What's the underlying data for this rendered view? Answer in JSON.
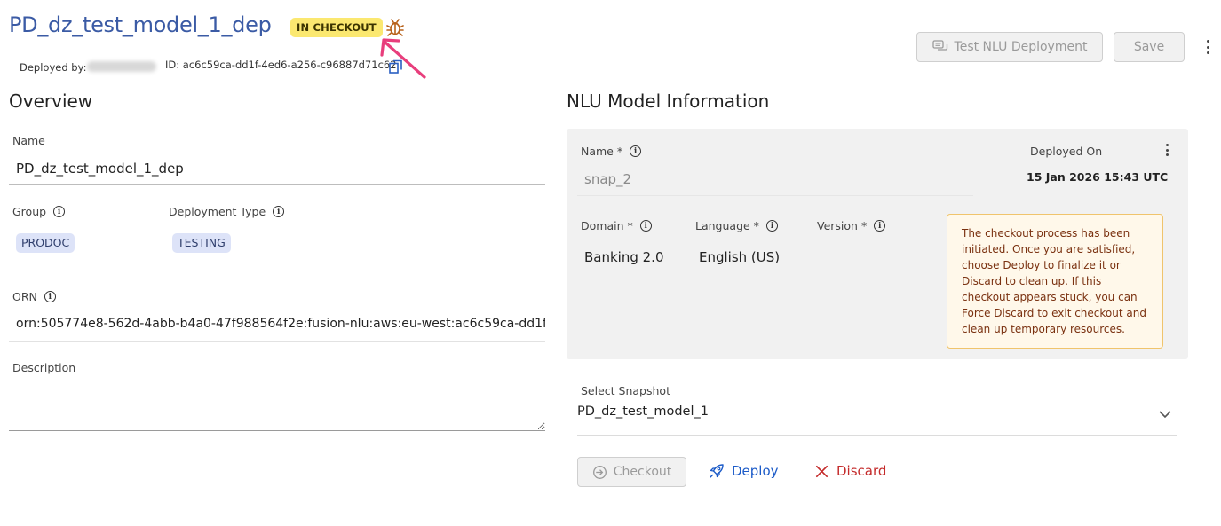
{
  "header": {
    "title": "PD_dz_test_model_1_dep",
    "status_badge": "IN CHECKOUT",
    "deployed_by_label": "Deployed by:",
    "id_text": "ID:  ac6c59ca-dd1f-4ed6-a256-c96887d71c62",
    "test_button": "Test NLU Deployment",
    "save_button": "Save"
  },
  "overview": {
    "heading": "Overview",
    "name_label": "Name",
    "name_value": "PD_dz_test_model_1_dep",
    "group_label": "Group",
    "group_value": "PRODOC",
    "deployment_type_label": "Deployment Type",
    "deployment_type_value": "TESTING",
    "orn_label": "ORN",
    "orn_value": "orn:505774e8-562d-4abb-b4a0-47f988564f2e:fusion-nlu:aws:eu-west:ac6c59ca-dd1f-",
    "description_label": "Description"
  },
  "nlu": {
    "heading": "NLU Model Information",
    "name_label": "Name *",
    "name_value": "snap_2",
    "deployed_on_label": "Deployed On",
    "deployed_on_value": "15 Jan 2026 15:43 UTC",
    "domain_label": "Domain *",
    "domain_value": "Banking 2.0",
    "language_label": "Language *",
    "language_value": "English (US)",
    "version_label": "Version *",
    "warning_text_1": "The checkout process has been initiated. Once you are satisfied, choose Deploy to finalize it or Discard to clean up. If this checkout appears stuck, you can ",
    "warning_link": "Force Discard",
    "warning_text_2": " to exit checkout and clean up temporary resources.",
    "snapshot_label": "Select Snapshot",
    "snapshot_value": "PD_dz_test_model_1"
  },
  "actions": {
    "checkout": "Checkout",
    "deploy": "Deploy",
    "discard": "Discard"
  },
  "colors": {
    "title": "#3b5ba5",
    "badge": "#fbe870",
    "annotation_arrow": "#e83e7c",
    "deploy": "#1c5bc8",
    "discard": "#c42a2a"
  }
}
